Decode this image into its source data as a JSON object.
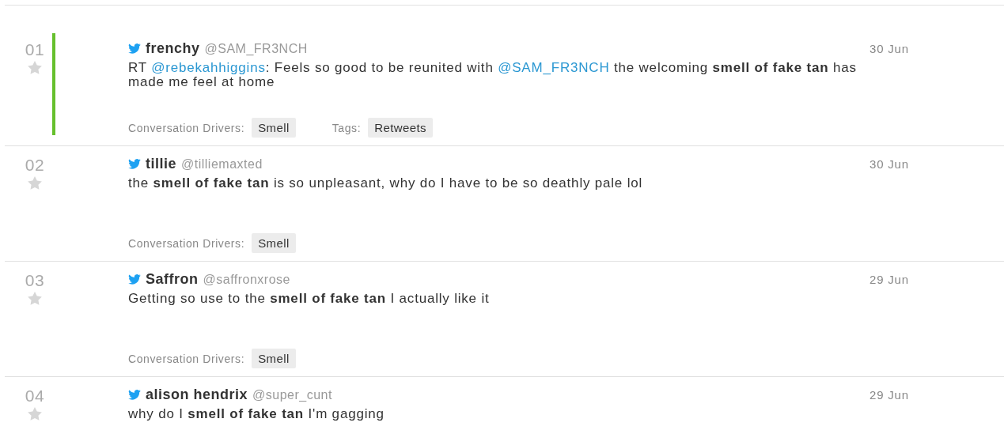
{
  "tweets": [
    {
      "number": "01",
      "starred": false,
      "highlighted": true,
      "name": "frenchy",
      "handle": "@SAM_FR3NCH",
      "date": "30 Jun",
      "text": [
        {
          "kind": "plain",
          "text": "RT "
        },
        {
          "kind": "mention",
          "text": "@rebekahhiggins"
        },
        {
          "kind": "plain",
          "text": ": Feels so good to be reunited with "
        },
        {
          "kind": "mention",
          "text": "@SAM_FR3NCH"
        },
        {
          "kind": "plain",
          "text": " the welcoming "
        },
        {
          "kind": "bold",
          "text": "smell of fake tan"
        },
        {
          "kind": "plain",
          "text": " has made me feel at home"
        }
      ],
      "meta": [
        {
          "label": "Conversation Drivers:",
          "value": "Smell"
        },
        {
          "label": "Tags:",
          "value": "Retweets"
        }
      ]
    },
    {
      "number": "02",
      "starred": false,
      "highlighted": false,
      "name": "tillie",
      "handle": "@tilliemaxted",
      "date": "30 Jun",
      "text": [
        {
          "kind": "plain",
          "text": "the "
        },
        {
          "kind": "bold",
          "text": "smell of fake tan"
        },
        {
          "kind": "plain",
          "text": " is so unpleasant, why do I have to be so deathly pale lol"
        }
      ],
      "meta": [
        {
          "label": "Conversation Drivers:",
          "value": "Smell"
        }
      ]
    },
    {
      "number": "03",
      "starred": false,
      "highlighted": false,
      "name": "Saffron",
      "handle": "@saffronxrose",
      "date": "29 Jun",
      "text": [
        {
          "kind": "plain",
          "text": "Getting so use to the "
        },
        {
          "kind": "bold",
          "text": "smell of fake tan"
        },
        {
          "kind": "plain",
          "text": " I actually like it"
        }
      ],
      "meta": [
        {
          "label": "Conversation Drivers:",
          "value": "Smell"
        }
      ]
    },
    {
      "number": "04",
      "starred": false,
      "highlighted": false,
      "name": "alison hendrix",
      "handle": "@super_cunt",
      "date": "29 Jun",
      "text": [
        {
          "kind": "plain",
          "text": "why do I "
        },
        {
          "kind": "bold",
          "text": "smell of fake tan"
        },
        {
          "kind": "plain",
          "text": " I'm gagging"
        }
      ]
    }
  ]
}
